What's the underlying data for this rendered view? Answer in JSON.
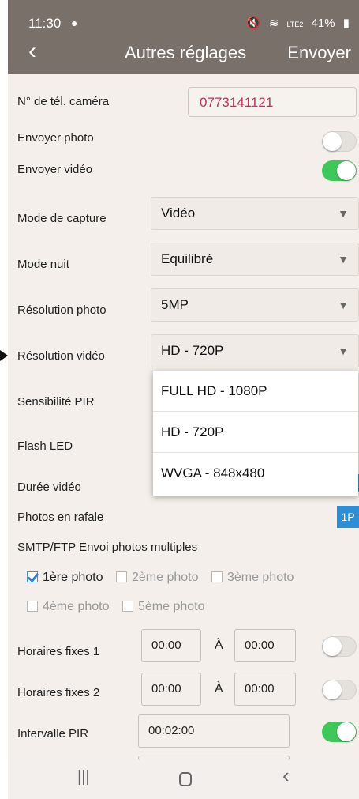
{
  "status_bar": {
    "time": "11:30",
    "message_icon": "chat-bubble-icon",
    "mute_icon": "🔇",
    "wifi_icon": "wifi-icon",
    "network_text": "LTE2",
    "battery": "41%"
  },
  "header": {
    "back_icon": "‹",
    "title": "Autres réglages",
    "send_label": "Envoyer"
  },
  "fields": {
    "camera_phone_label": "N° de tél. caméra",
    "camera_phone_value": "0773141121",
    "send_photo_label": "Envoyer photo",
    "send_photo_on": false,
    "send_video_label": "Envoyer vidéo",
    "send_video_on": true,
    "capture_mode_label": "Mode de capture",
    "capture_mode_value": "Vidéo",
    "night_mode_label": "Mode nuit",
    "night_mode_value": "Equilibré",
    "photo_res_label": "Résolution photo",
    "photo_res_value": "5MP",
    "video_res_label": "Résolution vidéo",
    "video_res_value": "HD - 720P",
    "pir_sensitivity_label": "Sensibilité PIR",
    "flash_led_label": "Flash LED",
    "video_duration_label": "Durée vidéo",
    "burst_label": "Photos en rafale",
    "burst_value": "1P",
    "smtp_label": "SMTP/FTP Envoi photos multiples"
  },
  "dropdown_options": [
    "FULL HD - 1080P",
    "HD - 720P",
    "WVGA - 848x480"
  ],
  "photo_checks": [
    {
      "label": "1ère photo",
      "checked": true
    },
    {
      "label": "2ème photo",
      "checked": false
    },
    {
      "label": "3ème photo",
      "checked": false
    },
    {
      "label": "4ème photo",
      "checked": false
    },
    {
      "label": "5ème photo",
      "checked": false
    }
  ],
  "schedules": {
    "fixed1_label": "Horaires fixes 1",
    "fixed1_from": "00:00",
    "fixed1_sep": "À",
    "fixed1_to": "00:00",
    "fixed1_on": false,
    "fixed2_label": "Horaires fixes 2",
    "fixed2_from": "00:00",
    "fixed2_sep": "À",
    "fixed2_to": "00:00",
    "fixed2_on": false,
    "pir_interval_label": "Intervalle PIR",
    "pir_interval_value": "00:02:00",
    "pir_interval_on": true
  },
  "navbar": {
    "recent_icon": "|||",
    "home_icon": "home-icon",
    "back_icon": "‹"
  },
  "colors": {
    "header_bg": "#7a706a",
    "content_bg": "#f4efea",
    "toggle_on": "#3fc85a",
    "accent_blue": "#2a8fd6",
    "phone_text": "#c0355a"
  }
}
